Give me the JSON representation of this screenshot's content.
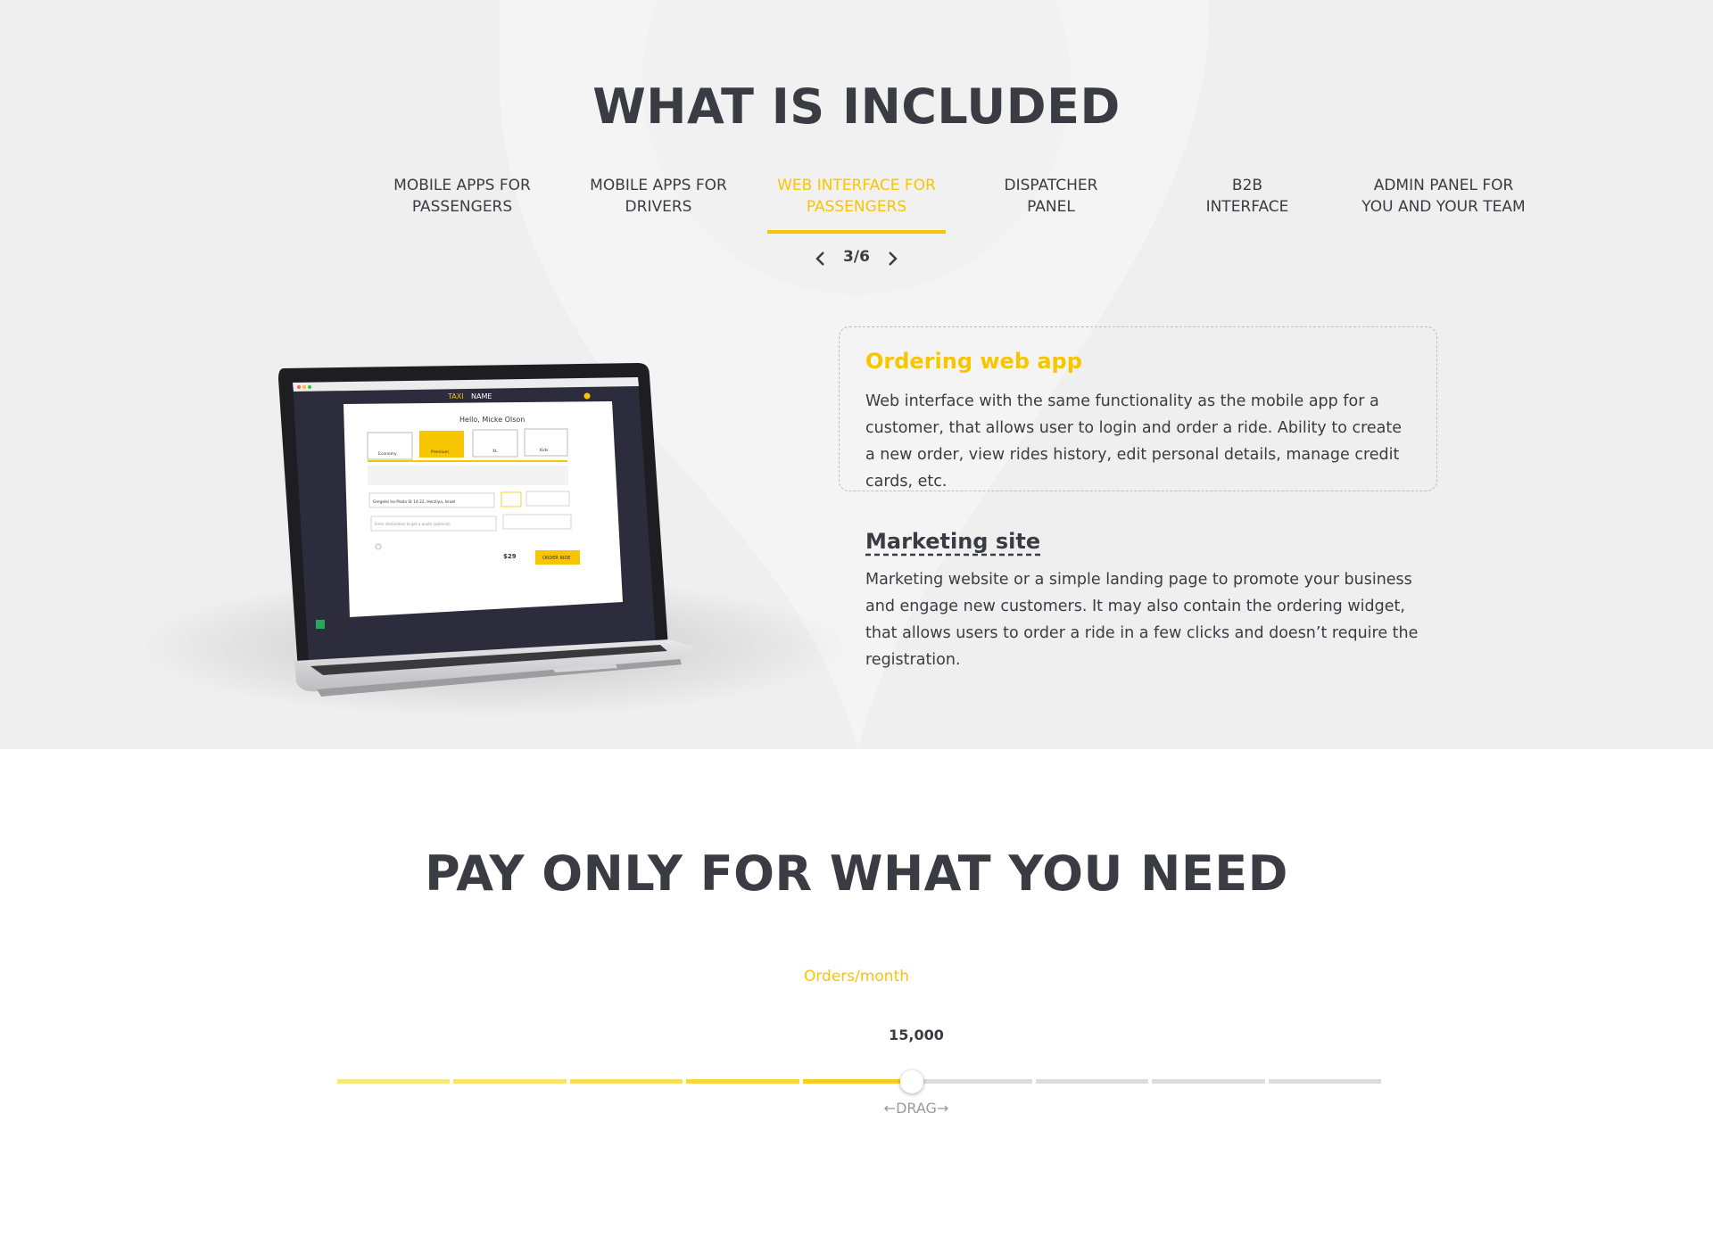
{
  "included": {
    "title": "WHAT IS INCLUDED",
    "tabs": [
      {
        "line1": "MOBILE APPS FOR",
        "line2": "PASSENGERS"
      },
      {
        "line1": "MOBILE APPS FOR",
        "line2": "DRIVERS"
      },
      {
        "line1": "WEB INTERFACE FOR",
        "line2": "PASSENGERS"
      },
      {
        "line1": "DISPATCHER",
        "line2": "PANEL"
      },
      {
        "line1": "B2B",
        "line2": "INTERFACE"
      },
      {
        "line1": "ADMIN PANEL FOR",
        "line2": "YOU AND YOUR TEAM"
      }
    ],
    "active_tab": 3,
    "pager": {
      "current": "3",
      "separator": "/",
      "total": "6"
    },
    "features": [
      {
        "title": "Ordering web app",
        "description": "Web interface with the same functionality as the mobile app for a customer, that allows user to login and order a ride. Ability to create a new order, view rides history, edit personal details, manage credit cards, etc."
      },
      {
        "title": "Marketing site",
        "description": "Marketing website or a simple landing page to promote your business and engage new customers. It may also contain the ordering widget, that allows users to order a ride in a few clicks and doesn’t require the registration."
      }
    ],
    "laptop_screen": {
      "brand_1": "TAXI",
      "brand_2": "NAME",
      "greeting": "Hello, Micke Olson",
      "car_classes": [
        "Economy",
        "Premium",
        "XL",
        "Kids"
      ],
      "pickup_address": "Gergelei ha-Piada St 14-22, Herzliya, Israel",
      "destination_placeholder": "Enter destination to get a quote (optional)",
      "price": "$29",
      "order_button": "ORDER RIDE"
    }
  },
  "pricing": {
    "title": "PAY ONLY FOR WHAT YOU NEED",
    "orders_label": "Orders/month",
    "value": "15,000",
    "drag_label": "DRAG",
    "slider_position": 0.55,
    "segments": 9
  },
  "colors": {
    "accent": "#f7c600",
    "text": "#3b3b43",
    "track": "#dcdcdc",
    "section_bg": "#efefef"
  }
}
